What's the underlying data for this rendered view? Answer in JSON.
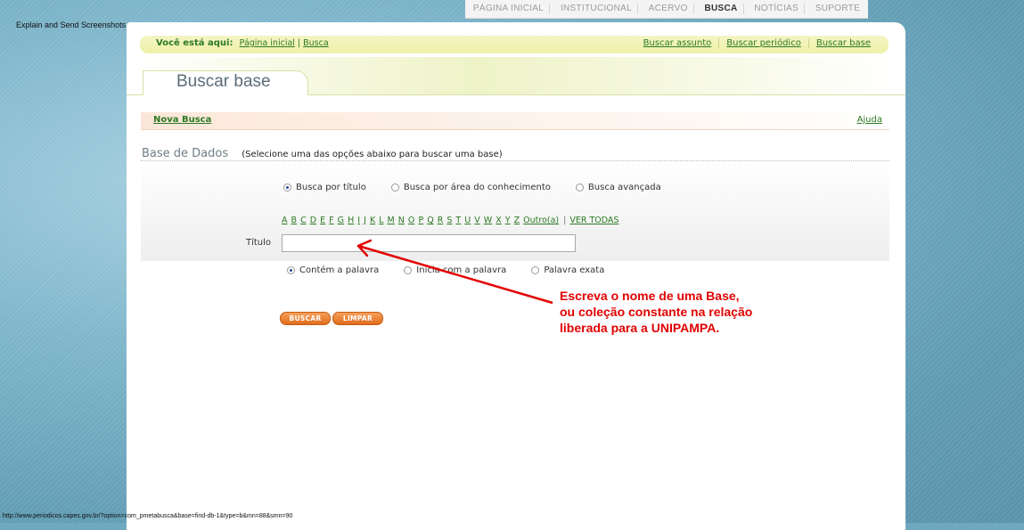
{
  "app": {
    "caption": "Explain and Send Screenshots"
  },
  "topnav": {
    "items": [
      "PÁGINA INICIAL",
      "INSTITUCIONAL",
      "ACERVO",
      "BUSCA",
      "NOTÍCIAS",
      "SUPORTE"
    ],
    "active": "BUSCA"
  },
  "breadcrumb": {
    "lead": "Você está aqui:",
    "home": "Página inicial",
    "separator": "|",
    "current": "Busca",
    "links": [
      "Buscar assunto",
      "Buscar periódico",
      "Buscar base"
    ]
  },
  "page": {
    "title": "Buscar base"
  },
  "nova_bar": {
    "nova": "Nova Busca",
    "ajuda": "Ajuda"
  },
  "section": {
    "title": "Base de Dados",
    "subtitle": "(Selecione uma das opções abaixo para buscar uma base)"
  },
  "search_type": {
    "options": [
      "Busca por título",
      "Busca por área do conhecimento",
      "Busca avançada"
    ],
    "selected": "Busca por título"
  },
  "letters": {
    "items": [
      "A",
      "B",
      "C",
      "D",
      "E",
      "F",
      "G",
      "H",
      "I",
      "J",
      "K",
      "L",
      "M",
      "N",
      "O",
      "P",
      "Q",
      "R",
      "S",
      "T",
      "U",
      "V",
      "W",
      "X",
      "Y",
      "Z",
      "Outro(a)"
    ],
    "separator": "|",
    "all": "VER TODAS"
  },
  "title_field": {
    "label": "Título",
    "value": ""
  },
  "match_mode": {
    "options": [
      "Contém a palavra",
      "Inicia com a palavra",
      "Palavra exata"
    ],
    "selected": "Contém a palavra"
  },
  "buttons": {
    "search": "BUSCAR",
    "clear": "LIMPAR"
  },
  "annotation": {
    "lines": [
      "Escreva o nome de uma Base,",
      "ou coleção constante na relação",
      "liberada para a UNIPAMPA."
    ],
    "color": "#e20000"
  },
  "status_bar": {
    "url": "http://www.periodicos.capes.gov.br/?option=com_pmetabusca&base=find-db-1&type=b&mn=88&smn=90"
  },
  "colors": {
    "link_green": "#2c7a23",
    "button_orange": "#e67a2a",
    "background_blue": "#6fa9bf"
  }
}
